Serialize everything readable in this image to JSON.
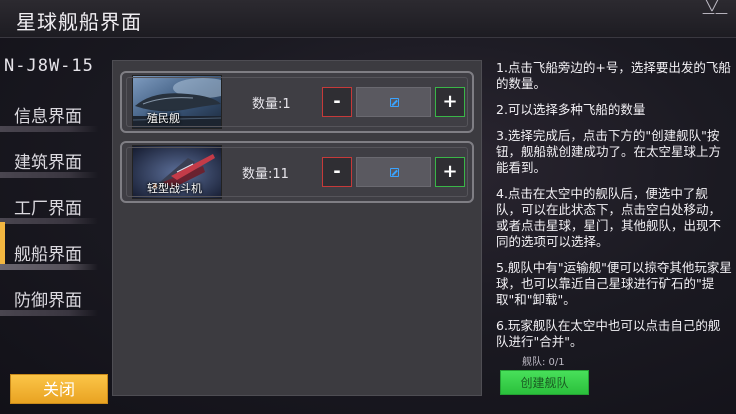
{
  "header": {
    "title": "星球舰船界面",
    "menu_icon": "chevron-down-icon"
  },
  "sector": "N-J8W-15",
  "sidebar": {
    "items": [
      {
        "label": "信息界面",
        "active": false
      },
      {
        "label": "建筑界面",
        "active": false
      },
      {
        "label": "工厂界面",
        "active": false
      },
      {
        "label": "舰船界面",
        "active": true
      },
      {
        "label": "防御界面",
        "active": false
      }
    ],
    "close_label": "关闭"
  },
  "ships": [
    {
      "name": "殖民舰",
      "count_label": "数量:1",
      "minus": "-",
      "plus": "+"
    },
    {
      "name": "轻型战斗机",
      "count_label": "数量:11",
      "minus": "-",
      "plus": "+"
    }
  ],
  "instructions": [
    "1.点击飞船旁边的+号，选择要出发的飞船的数量。",
    "2.可以选择多种飞船的数量",
    "3.选择完成后，点击下方的\"创建舰队\"按钮，舰船就创建成功了。在太空星球上方能看到。",
    "4.点击在太空中的舰队后，便选中了舰队，可以在此状态下，点击空白处移动，或者点击星球，星门，其他舰队，出现不同的选项可以选择。",
    "5.舰队中有\"运输舰\"便可以掠夺其他玩家星球，也可以靠近自己星球进行矿石的\"提取\"和\"卸载\"。",
    "6.玩家舰队在太空中也可以点击自己的舰队进行\"合并\"。"
  ],
  "fleet_status": "舰队: 0/1",
  "create_label": "创建舰队",
  "colors": {
    "accent": "#f2b640",
    "create": "#2bc03c",
    "minus_border": "#c63a3a",
    "plus_border": "#3ab648"
  }
}
